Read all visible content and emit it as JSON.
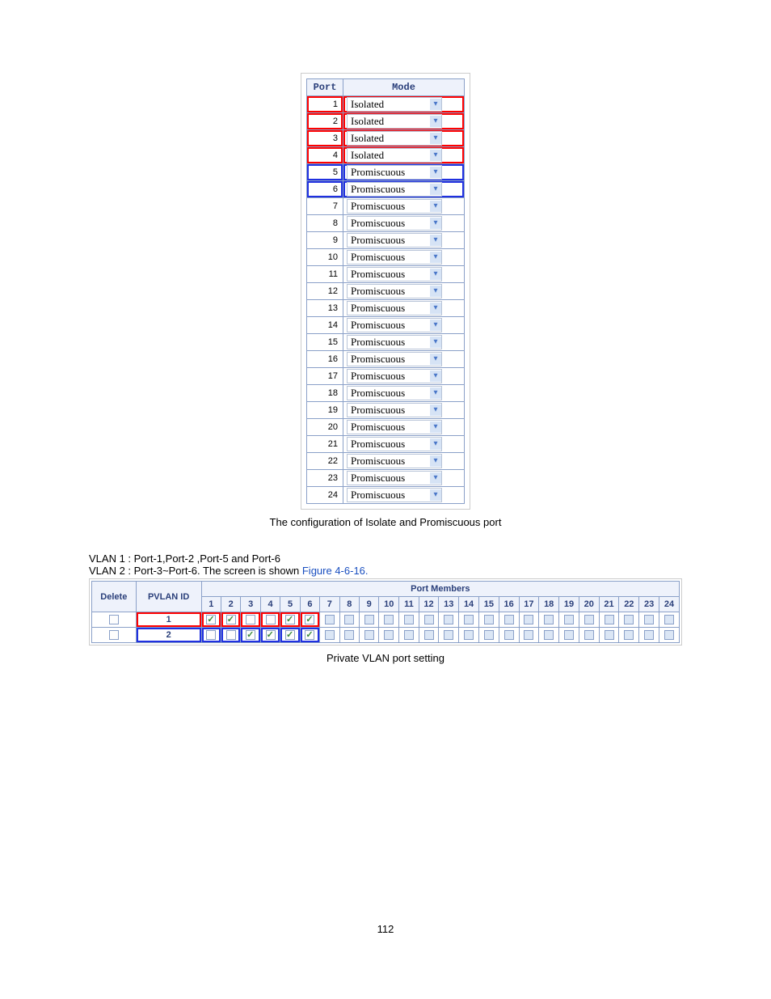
{
  "port_table": {
    "headers": {
      "port": "Port",
      "mode": "Mode"
    },
    "rows": [
      {
        "port": "1",
        "mode": "Isolated",
        "highlight": "red"
      },
      {
        "port": "2",
        "mode": "Isolated",
        "highlight": "red"
      },
      {
        "port": "3",
        "mode": "Isolated",
        "highlight": "red"
      },
      {
        "port": "4",
        "mode": "Isolated",
        "highlight": "red"
      },
      {
        "port": "5",
        "mode": "Promiscuous",
        "highlight": "blue"
      },
      {
        "port": "6",
        "mode": "Promiscuous",
        "highlight": "blue"
      },
      {
        "port": "7",
        "mode": "Promiscuous",
        "highlight": ""
      },
      {
        "port": "8",
        "mode": "Promiscuous",
        "highlight": ""
      },
      {
        "port": "9",
        "mode": "Promiscuous",
        "highlight": ""
      },
      {
        "port": "10",
        "mode": "Promiscuous",
        "highlight": ""
      },
      {
        "port": "11",
        "mode": "Promiscuous",
        "highlight": ""
      },
      {
        "port": "12",
        "mode": "Promiscuous",
        "highlight": ""
      },
      {
        "port": "13",
        "mode": "Promiscuous",
        "highlight": ""
      },
      {
        "port": "14",
        "mode": "Promiscuous",
        "highlight": ""
      },
      {
        "port": "15",
        "mode": "Promiscuous",
        "highlight": ""
      },
      {
        "port": "16",
        "mode": "Promiscuous",
        "highlight": ""
      },
      {
        "port": "17",
        "mode": "Promiscuous",
        "highlight": ""
      },
      {
        "port": "18",
        "mode": "Promiscuous",
        "highlight": ""
      },
      {
        "port": "19",
        "mode": "Promiscuous",
        "highlight": ""
      },
      {
        "port": "20",
        "mode": "Promiscuous",
        "highlight": ""
      },
      {
        "port": "21",
        "mode": "Promiscuous",
        "highlight": ""
      },
      {
        "port": "22",
        "mode": "Promiscuous",
        "highlight": ""
      },
      {
        "port": "23",
        "mode": "Promiscuous",
        "highlight": ""
      },
      {
        "port": "24",
        "mode": "Promiscuous",
        "highlight": ""
      }
    ]
  },
  "caption1": "The configuration of Isolate and Promiscuous port",
  "vlan_text": {
    "line1": "VLAN 1 : Port-1,Port-2 ,Port-5 and Port-6",
    "line2a": "VLAN 2 : Port-3~Port-6. The screen is shown ",
    "line2b": "Figure 4-6-16.",
    "line2b_suffix": ""
  },
  "mem_table": {
    "group_header": "Port Members",
    "cols": {
      "delete": "Delete",
      "pvlan": "PVLAN ID"
    },
    "port_nums": [
      "1",
      "2",
      "3",
      "4",
      "5",
      "6",
      "7",
      "8",
      "9",
      "10",
      "11",
      "12",
      "13",
      "14",
      "15",
      "16",
      "17",
      "18",
      "19",
      "20",
      "21",
      "22",
      "23",
      "24"
    ],
    "rows": [
      {
        "delete": false,
        "pvlan_id": "1",
        "members": [
          true,
          true,
          false,
          false,
          true,
          true,
          false,
          false,
          false,
          false,
          false,
          false,
          false,
          false,
          false,
          false,
          false,
          false,
          false,
          false,
          false,
          false,
          false,
          false
        ],
        "highlight_range": [
          1,
          6
        ],
        "highlight_color": "red",
        "dim_after": 6
      },
      {
        "delete": false,
        "pvlan_id": "2",
        "members": [
          false,
          false,
          true,
          true,
          true,
          true,
          false,
          false,
          false,
          false,
          false,
          false,
          false,
          false,
          false,
          false,
          false,
          false,
          false,
          false,
          false,
          false,
          false,
          false
        ],
        "highlight_range": [
          1,
          6
        ],
        "highlight_color": "blue",
        "dim_after": 6
      }
    ]
  },
  "caption2": "Private VLAN port setting",
  "page_number": "112"
}
